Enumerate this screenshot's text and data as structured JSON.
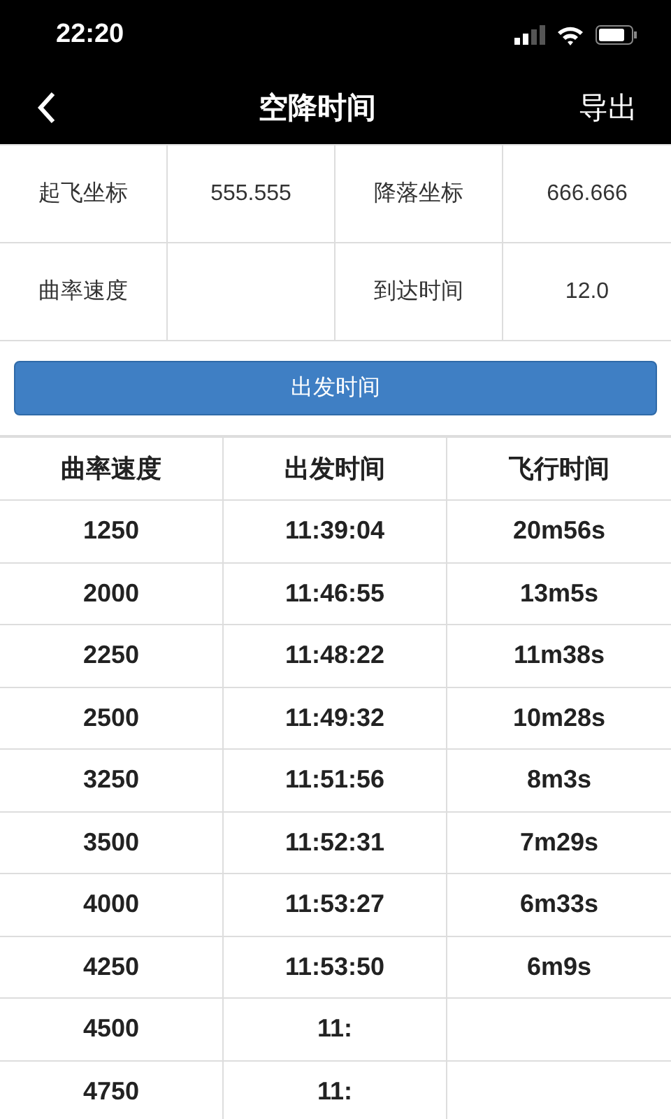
{
  "status_bar": {
    "time": "22:20"
  },
  "nav": {
    "title": "空降时间",
    "action": "导出"
  },
  "info": [
    {
      "label": "起飞坐标",
      "value": "555.555"
    },
    {
      "label": "降落坐标",
      "value": "666.666"
    },
    {
      "label": "曲率速度"
    },
    {
      "label": "到达时间",
      "value": "12.0"
    }
  ],
  "button": "出发时间",
  "table": {
    "columns": [
      "曲率速度",
      "出发时间",
      "飞行时间"
    ],
    "rows": [
      [
        "1250",
        "11:39:04",
        "20m56s"
      ],
      [
        "2000",
        "11:46:55",
        "13m5s"
      ],
      [
        "2250",
        "11:48:22",
        "11m38s"
      ],
      [
        "2500",
        "11:49:32",
        "10m28s"
      ],
      [
        "3250",
        "11:51:56",
        "8m3s"
      ],
      [
        "3500",
        "11:52:31",
        "7m29s"
      ],
      [
        "4000",
        "11:53:27",
        "6m33s"
      ],
      [
        "4250",
        "11:53:50",
        "6m9s"
      ],
      [
        "4500",
        "11:"
      ],
      [
        "4750",
        "11:"
      ]
    ]
  }
}
